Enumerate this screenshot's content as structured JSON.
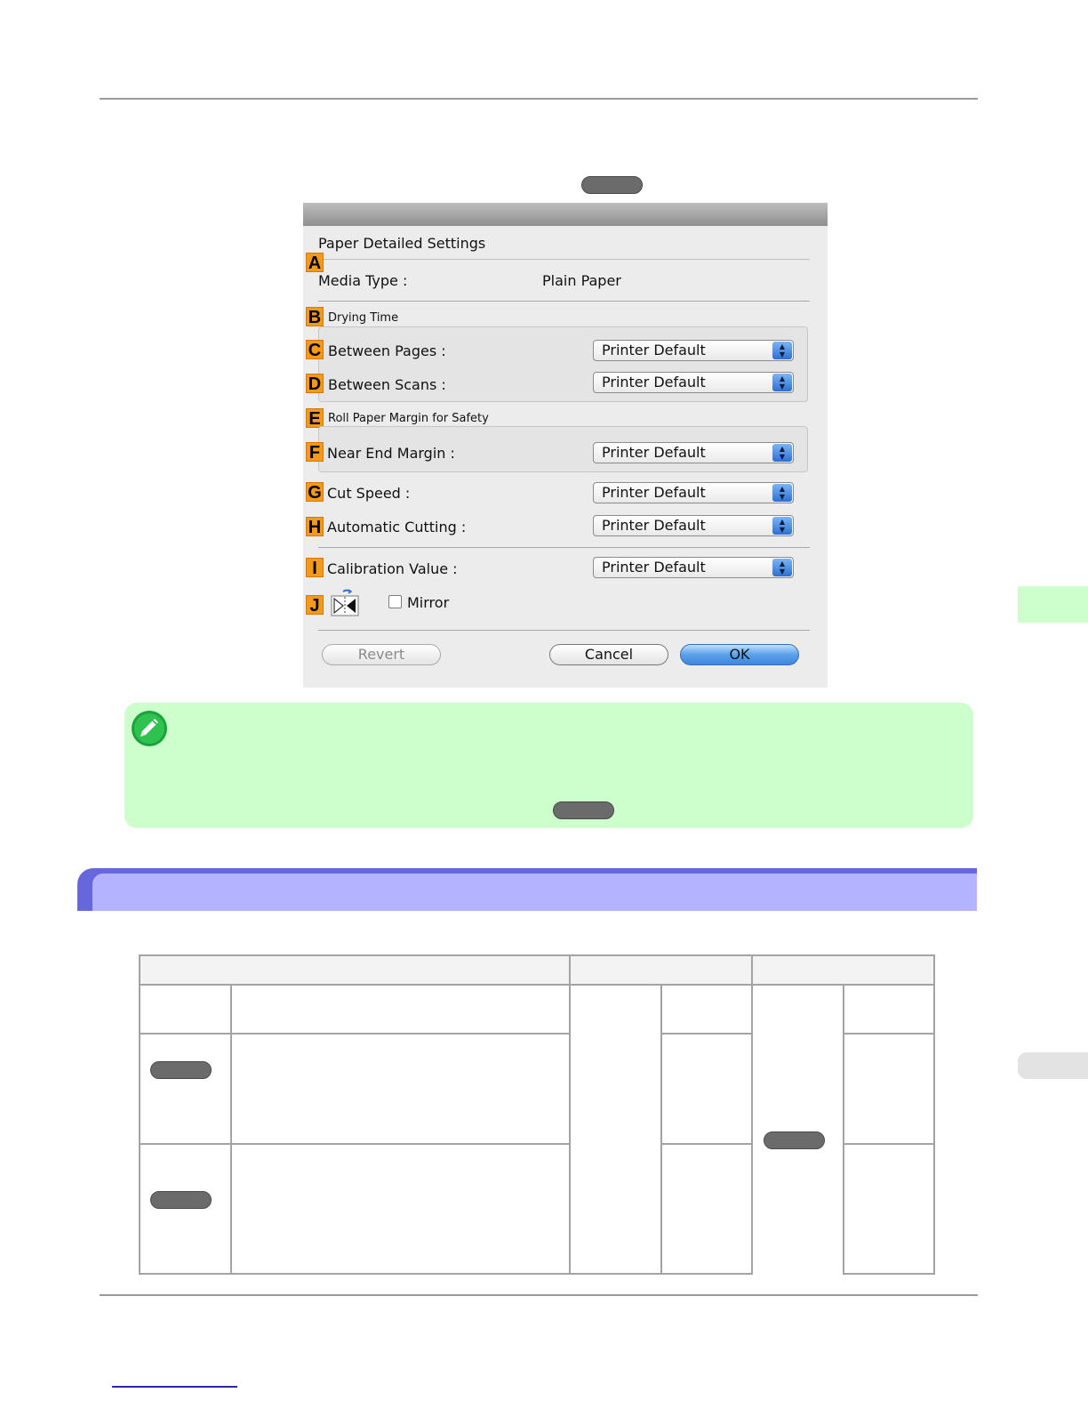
{
  "dialog": {
    "section_title": "Paper Detailed Settings",
    "rows": [
      {
        "badge": "A",
        "label": "Media Type :",
        "value": "Plain Paper"
      },
      {
        "badge": "B",
        "label": "Drying Time"
      },
      {
        "badge": "C",
        "label": "Between Pages :",
        "popup": "Printer Default"
      },
      {
        "badge": "D",
        "label": "Between Scans :",
        "popup": "Printer Default"
      },
      {
        "badge": "E",
        "label": "Roll Paper Margin for Safety"
      },
      {
        "badge": "F",
        "label": "Near End Margin :",
        "popup": "Printer Default"
      },
      {
        "badge": "G",
        "label": "Cut Speed :",
        "popup": "Printer Default"
      },
      {
        "badge": "H",
        "label": "Automatic Cutting :",
        "popup": "Printer Default"
      },
      {
        "badge": "I",
        "label": "Calibration Value :",
        "popup": "Printer Default"
      },
      {
        "badge": "J",
        "label": "Mirror",
        "checked": false
      }
    ],
    "buttons": {
      "revert": "Revert",
      "cancel": "Cancel",
      "ok": "OK"
    }
  },
  "icons": {
    "note": "pencil-note-icon",
    "mirror": "mirror-flip-icon",
    "popup_arrows": "up-down-arrows-icon"
  },
  "colors": {
    "badge": "#f39a1e",
    "note_background": "#ccffcc",
    "section_header_outer": "#6666dd",
    "section_header_inner": "#b3b3ff",
    "default_button": "#3d86dc"
  }
}
